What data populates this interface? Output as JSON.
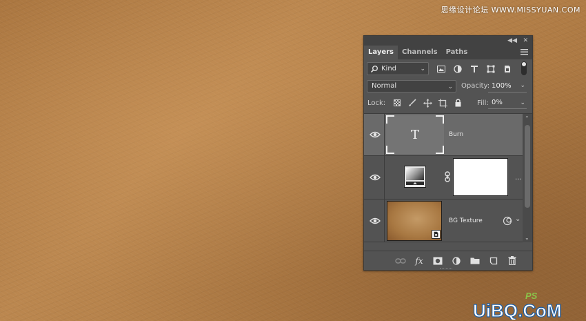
{
  "watermark": {
    "top_text": "思缘设计论坛 WWW.MISSYUAN.COM",
    "logo_text": "UiBQ.CoM",
    "logo_ps": "PS"
  },
  "panel": {
    "tabs": [
      {
        "label": "Layers",
        "active": true
      },
      {
        "label": "Channels",
        "active": false
      },
      {
        "label": "Paths",
        "active": false
      }
    ],
    "filter": {
      "kind_label": "Kind",
      "icons": [
        "image-filter-icon",
        "adjustment-filter-icon",
        "type-filter-icon",
        "shape-filter-icon",
        "smart-object-filter-icon"
      ]
    },
    "blend": {
      "mode": "Normal",
      "opacity_label": "Opacity:",
      "opacity_value": "100%"
    },
    "lock": {
      "label": "Lock:",
      "icons": [
        "lock-transparent-icon",
        "lock-image-icon",
        "lock-position-icon",
        "lock-artboard-icon",
        "lock-all-icon"
      ],
      "fill_label": "Fill:",
      "fill_value": "0%"
    },
    "layers": [
      {
        "name": "Burn",
        "type": "text",
        "selected": true,
        "visible": true
      },
      {
        "name": "",
        "type": "adjustment",
        "selected": false,
        "visible": true,
        "more": "..."
      },
      {
        "name": "BG Texture",
        "type": "smart-object",
        "selected": false,
        "visible": true
      }
    ],
    "footer_icons": [
      "link-layers-icon",
      "fx-icon",
      "add-mask-icon",
      "new-adjustment-icon",
      "new-group-icon",
      "new-layer-icon",
      "delete-layer-icon"
    ],
    "fx_label": "fx"
  },
  "colors": {
    "panel_bg": "#535353",
    "selected_row": "#6a6a6a",
    "leather": "#b07c45"
  }
}
